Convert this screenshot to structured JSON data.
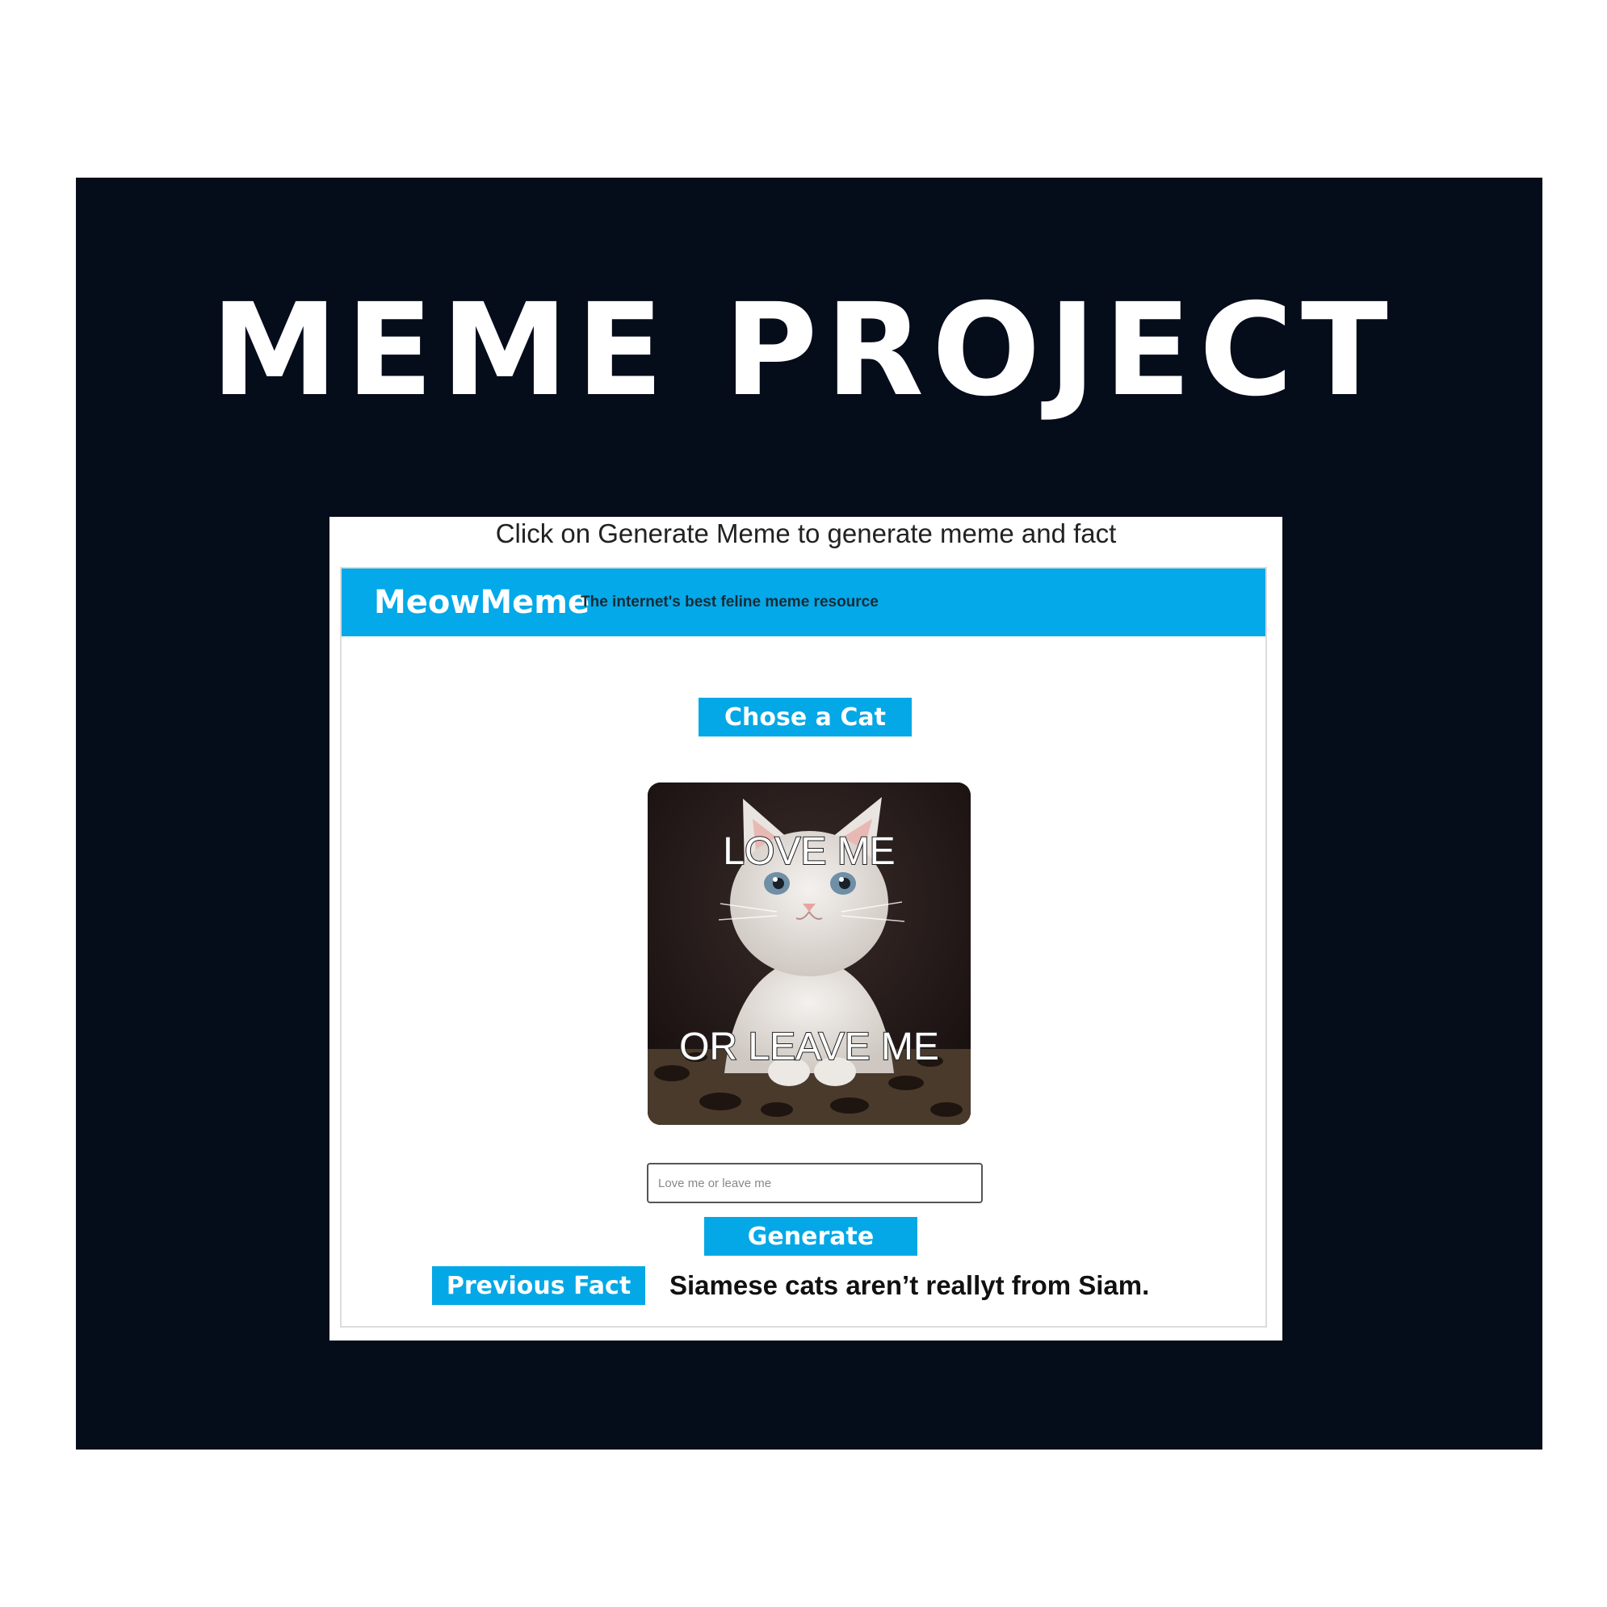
{
  "poster": {
    "title": "MEME PROJECT",
    "background_color": "#050c1a"
  },
  "app": {
    "instruction": "Click on Generate Meme to generate meme and fact",
    "header": {
      "brand": "MeowMeme",
      "tagline": "The internet's best feline meme resource",
      "background_color": "#03a9e8"
    },
    "choose_cat_label": "Chose a Cat",
    "meme": {
      "top_text": "LOVE ME",
      "bottom_text": "OR LEAVE ME",
      "image_icon": "white-kitten-photo"
    },
    "input": {
      "placeholder": "Love me or leave me",
      "value": ""
    },
    "generate_label": "Generate Meme",
    "previous_fact_label": "Previous Fact",
    "fact": "Siamese cats aren’t reallyt from Siam.",
    "accent_color": "#04a8e6"
  }
}
